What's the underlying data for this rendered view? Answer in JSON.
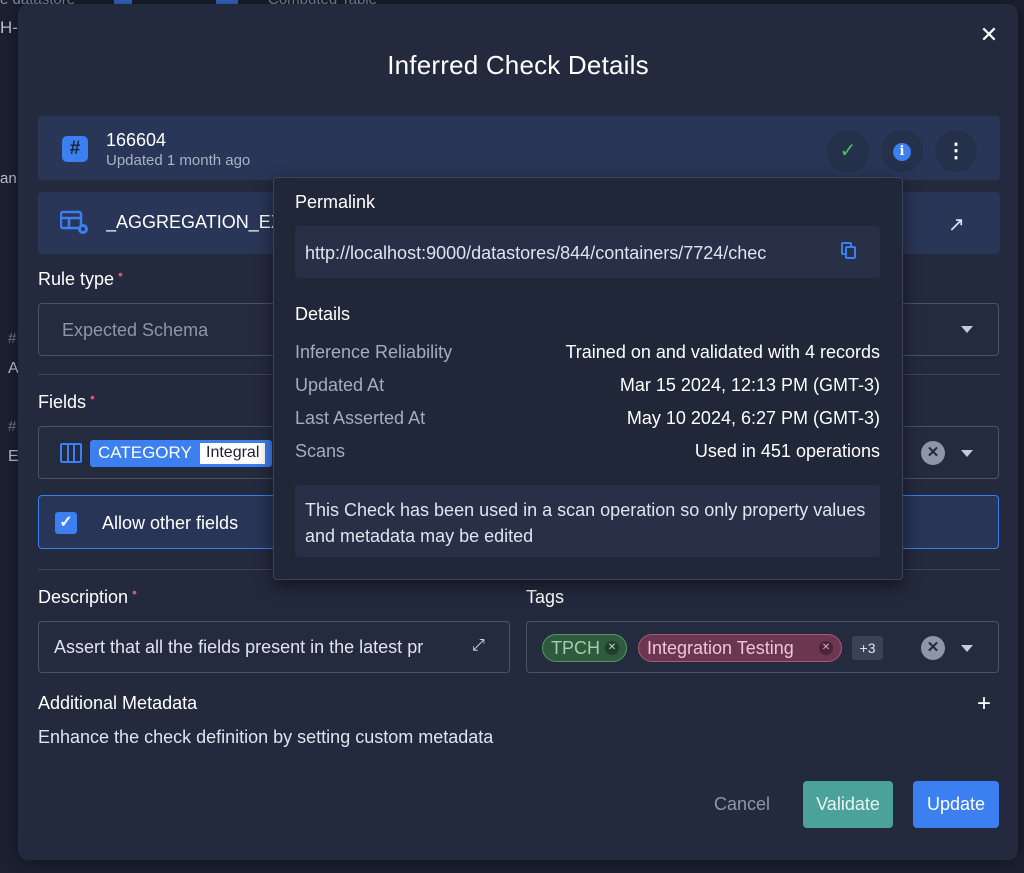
{
  "background": {
    "top_left_text": "e datastore",
    "top_mid_text": "Computed Table",
    "side_heading": "H-",
    "side_text": "an",
    "side_hash": "#",
    "side_letters": [
      "A",
      "E"
    ]
  },
  "modal": {
    "title": "Inferred Check Details",
    "close_symbol": "✕",
    "check": {
      "id": "166604",
      "updated": "Updated 1 month ago",
      "hash_symbol": "#",
      "ok_symbol": "✓",
      "info_symbol": "i",
      "more_symbol": "⋮"
    },
    "container": {
      "name": "_AGGREGATION_EX",
      "open_symbol": "↗"
    },
    "rule_type": {
      "label": "Rule type",
      "required": "•",
      "value": "Expected Schema"
    },
    "fields": {
      "label": "Fields",
      "required": "•",
      "chip_name": "CATEGORY",
      "chip_type": "Integral",
      "clear_symbol": "✕"
    },
    "allow_other_fields": {
      "label": "Allow other fields",
      "checked_symbol": "✓"
    },
    "description": {
      "label": "Description",
      "required": "•",
      "value": "Assert that all the fields present in the latest pr",
      "expand_symbol": "⤢"
    },
    "tags": {
      "label": "Tags",
      "items": [
        {
          "label": "TPCH",
          "color": "#4f9a5a"
        },
        {
          "label": "Integration Testing",
          "color": "#b0557e"
        }
      ],
      "remove_symbol": "✕",
      "more": "+3",
      "clear_symbol": "✕"
    },
    "metadata": {
      "label": "Additional Metadata",
      "description": "Enhance the check definition by setting custom metadata",
      "add_symbol": "+"
    },
    "buttons": {
      "cancel": "Cancel",
      "validate": "Validate",
      "update": "Update"
    }
  },
  "popover": {
    "permalink_label": "Permalink",
    "permalink": "http://localhost:9000/datastores/844/containers/7724/chec",
    "details_label": "Details",
    "details": [
      {
        "label": "Inference Reliability",
        "value": "Trained on and validated with 4 records"
      },
      {
        "label": "Updated At",
        "value": "Mar 15 2024, 12:13 PM (GMT-3)"
      },
      {
        "label": "Last Asserted At",
        "value": "May 10 2024, 6:27 PM (GMT-3)"
      },
      {
        "label": "Scans",
        "value": "Used in 451 operations"
      }
    ],
    "note": "This Check has been used in a scan operation so only property values and metadata may be edited"
  },
  "colors": {
    "accent": "#3b7ff0",
    "success": "#4fbf68",
    "validate": "#4aa29a",
    "required": "#e2536b"
  }
}
